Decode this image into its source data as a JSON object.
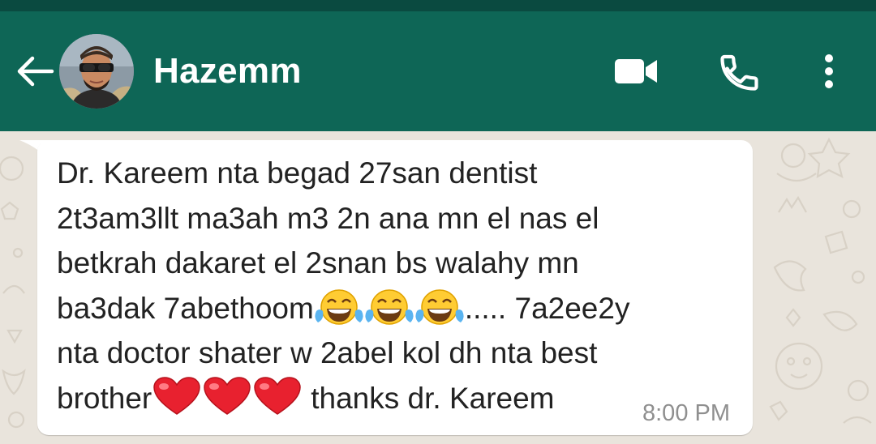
{
  "header": {
    "contact_name": "Hazemm",
    "background_color": "#0e6656",
    "icons": {
      "back": "arrow-left-icon",
      "video": "video-camera-icon",
      "call": "phone-icon",
      "menu": "more-vert-icon"
    }
  },
  "message": {
    "lines": [
      "Dr. Kareem nta begad 27san dentist",
      "2t3am3llt ma3ah m3 2n ana mn el nas el",
      "betkrah dakaret el 2snan bs walahy mn",
      "ba3dak 7abethoom",
      "..... 7a2ee2y",
      "nta doctor shater w 2abel kol dh nta best",
      "brother",
      "thanks dr. Kareem"
    ],
    "emojis_line4": [
      "face-with-tears-of-joy",
      "face-with-tears-of-joy",
      "face-with-tears-of-joy"
    ],
    "emojis_line6": [
      "red-heart",
      "red-heart",
      "red-heart"
    ],
    "time": "8:00 PM",
    "bubble_color": "#ffffff"
  },
  "wallpaper": {
    "color": "#e9e4dc"
  }
}
